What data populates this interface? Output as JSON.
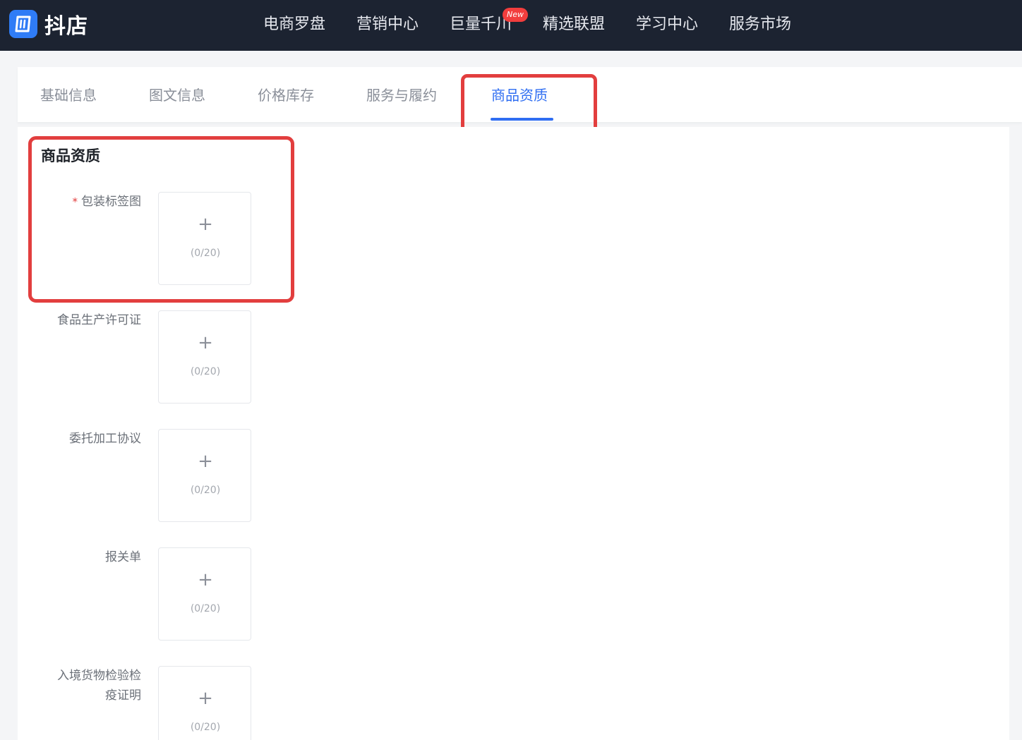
{
  "header": {
    "logo_icon": "app-logo-icon",
    "logo_text": "抖店",
    "nav": [
      "电商罗盘",
      "营销中心",
      "巨量千川",
      "精选联盟",
      "学习中心",
      "服务市场"
    ],
    "new_badge": "New"
  },
  "tabs": [
    "基础信息",
    "图文信息",
    "价格库存",
    "服务与履约",
    "商品资质"
  ],
  "active_tab": "商品资质",
  "colors": {
    "accent": "#2f6ef2",
    "highlight": "#e23e3e",
    "topbar": "#1c2331"
  },
  "section": {
    "title": "商品资质",
    "fields": [
      {
        "label": "包装标签图",
        "required": true,
        "plus_icon": "plus-icon",
        "count": "(0/20)"
      },
      {
        "label": "食品生产许可证",
        "required": false,
        "plus_icon": "plus-icon",
        "count": "(0/20)"
      },
      {
        "label": "委托加工协议",
        "required": false,
        "plus_icon": "plus-icon",
        "count": "(0/20)"
      },
      {
        "label": "报关单",
        "required": false,
        "plus_icon": "plus-icon",
        "count": "(0/20)"
      },
      {
        "label_line1": "入境货物检验检",
        "label_line2": "疫证明",
        "required": false,
        "plus_icon": "plus-icon",
        "count": "(0/20)"
      }
    ]
  },
  "symbols": {
    "plus": "+",
    "required_mark": "*"
  }
}
